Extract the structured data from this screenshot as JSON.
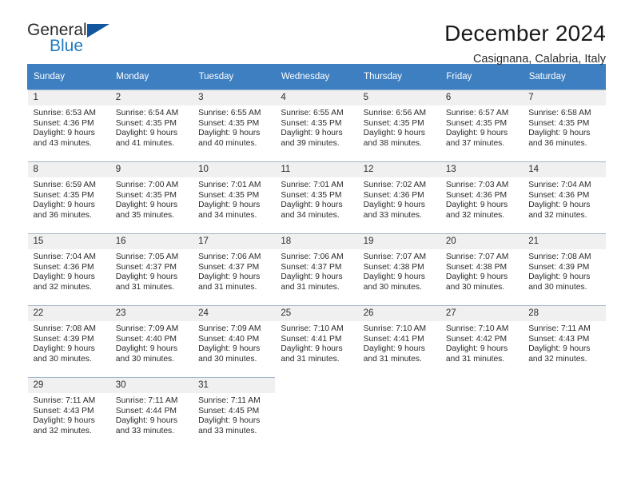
{
  "brand": {
    "name_primary": "General",
    "name_secondary": "Blue",
    "color_primary": "#2b2b2b",
    "color_secondary": "#1f7ac0",
    "triangle_color": "#1256a0"
  },
  "header": {
    "title": "December 2024",
    "subtitle": "Casignana, Calabria, Italy"
  },
  "theme": {
    "header_bg": "#3d7fc1",
    "header_text": "#ffffff",
    "daynum_bg": "#f0f0f0",
    "cell_border": "#9fb6cc",
    "body_text": "#2b2b2b"
  },
  "weekdays": [
    "Sunday",
    "Monday",
    "Tuesday",
    "Wednesday",
    "Thursday",
    "Friday",
    "Saturday"
  ],
  "weeks": [
    [
      {
        "day": "1",
        "sunrise": "Sunrise: 6:53 AM",
        "sunset": "Sunset: 4:36 PM",
        "daylight1": "Daylight: 9 hours",
        "daylight2": "and 43 minutes."
      },
      {
        "day": "2",
        "sunrise": "Sunrise: 6:54 AM",
        "sunset": "Sunset: 4:35 PM",
        "daylight1": "Daylight: 9 hours",
        "daylight2": "and 41 minutes."
      },
      {
        "day": "3",
        "sunrise": "Sunrise: 6:55 AM",
        "sunset": "Sunset: 4:35 PM",
        "daylight1": "Daylight: 9 hours",
        "daylight2": "and 40 minutes."
      },
      {
        "day": "4",
        "sunrise": "Sunrise: 6:55 AM",
        "sunset": "Sunset: 4:35 PM",
        "daylight1": "Daylight: 9 hours",
        "daylight2": "and 39 minutes."
      },
      {
        "day": "5",
        "sunrise": "Sunrise: 6:56 AM",
        "sunset": "Sunset: 4:35 PM",
        "daylight1": "Daylight: 9 hours",
        "daylight2": "and 38 minutes."
      },
      {
        "day": "6",
        "sunrise": "Sunrise: 6:57 AM",
        "sunset": "Sunset: 4:35 PM",
        "daylight1": "Daylight: 9 hours",
        "daylight2": "and 37 minutes."
      },
      {
        "day": "7",
        "sunrise": "Sunrise: 6:58 AM",
        "sunset": "Sunset: 4:35 PM",
        "daylight1": "Daylight: 9 hours",
        "daylight2": "and 36 minutes."
      }
    ],
    [
      {
        "day": "8",
        "sunrise": "Sunrise: 6:59 AM",
        "sunset": "Sunset: 4:35 PM",
        "daylight1": "Daylight: 9 hours",
        "daylight2": "and 36 minutes."
      },
      {
        "day": "9",
        "sunrise": "Sunrise: 7:00 AM",
        "sunset": "Sunset: 4:35 PM",
        "daylight1": "Daylight: 9 hours",
        "daylight2": "and 35 minutes."
      },
      {
        "day": "10",
        "sunrise": "Sunrise: 7:01 AM",
        "sunset": "Sunset: 4:35 PM",
        "daylight1": "Daylight: 9 hours",
        "daylight2": "and 34 minutes."
      },
      {
        "day": "11",
        "sunrise": "Sunrise: 7:01 AM",
        "sunset": "Sunset: 4:35 PM",
        "daylight1": "Daylight: 9 hours",
        "daylight2": "and 34 minutes."
      },
      {
        "day": "12",
        "sunrise": "Sunrise: 7:02 AM",
        "sunset": "Sunset: 4:36 PM",
        "daylight1": "Daylight: 9 hours",
        "daylight2": "and 33 minutes."
      },
      {
        "day": "13",
        "sunrise": "Sunrise: 7:03 AM",
        "sunset": "Sunset: 4:36 PM",
        "daylight1": "Daylight: 9 hours",
        "daylight2": "and 32 minutes."
      },
      {
        "day": "14",
        "sunrise": "Sunrise: 7:04 AM",
        "sunset": "Sunset: 4:36 PM",
        "daylight1": "Daylight: 9 hours",
        "daylight2": "and 32 minutes."
      }
    ],
    [
      {
        "day": "15",
        "sunrise": "Sunrise: 7:04 AM",
        "sunset": "Sunset: 4:36 PM",
        "daylight1": "Daylight: 9 hours",
        "daylight2": "and 32 minutes."
      },
      {
        "day": "16",
        "sunrise": "Sunrise: 7:05 AM",
        "sunset": "Sunset: 4:37 PM",
        "daylight1": "Daylight: 9 hours",
        "daylight2": "and 31 minutes."
      },
      {
        "day": "17",
        "sunrise": "Sunrise: 7:06 AM",
        "sunset": "Sunset: 4:37 PM",
        "daylight1": "Daylight: 9 hours",
        "daylight2": "and 31 minutes."
      },
      {
        "day": "18",
        "sunrise": "Sunrise: 7:06 AM",
        "sunset": "Sunset: 4:37 PM",
        "daylight1": "Daylight: 9 hours",
        "daylight2": "and 31 minutes."
      },
      {
        "day": "19",
        "sunrise": "Sunrise: 7:07 AM",
        "sunset": "Sunset: 4:38 PM",
        "daylight1": "Daylight: 9 hours",
        "daylight2": "and 30 minutes."
      },
      {
        "day": "20",
        "sunrise": "Sunrise: 7:07 AM",
        "sunset": "Sunset: 4:38 PM",
        "daylight1": "Daylight: 9 hours",
        "daylight2": "and 30 minutes."
      },
      {
        "day": "21",
        "sunrise": "Sunrise: 7:08 AM",
        "sunset": "Sunset: 4:39 PM",
        "daylight1": "Daylight: 9 hours",
        "daylight2": "and 30 minutes."
      }
    ],
    [
      {
        "day": "22",
        "sunrise": "Sunrise: 7:08 AM",
        "sunset": "Sunset: 4:39 PM",
        "daylight1": "Daylight: 9 hours",
        "daylight2": "and 30 minutes."
      },
      {
        "day": "23",
        "sunrise": "Sunrise: 7:09 AM",
        "sunset": "Sunset: 4:40 PM",
        "daylight1": "Daylight: 9 hours",
        "daylight2": "and 30 minutes."
      },
      {
        "day": "24",
        "sunrise": "Sunrise: 7:09 AM",
        "sunset": "Sunset: 4:40 PM",
        "daylight1": "Daylight: 9 hours",
        "daylight2": "and 30 minutes."
      },
      {
        "day": "25",
        "sunrise": "Sunrise: 7:10 AM",
        "sunset": "Sunset: 4:41 PM",
        "daylight1": "Daylight: 9 hours",
        "daylight2": "and 31 minutes."
      },
      {
        "day": "26",
        "sunrise": "Sunrise: 7:10 AM",
        "sunset": "Sunset: 4:41 PM",
        "daylight1": "Daylight: 9 hours",
        "daylight2": "and 31 minutes."
      },
      {
        "day": "27",
        "sunrise": "Sunrise: 7:10 AM",
        "sunset": "Sunset: 4:42 PM",
        "daylight1": "Daylight: 9 hours",
        "daylight2": "and 31 minutes."
      },
      {
        "day": "28",
        "sunrise": "Sunrise: 7:11 AM",
        "sunset": "Sunset: 4:43 PM",
        "daylight1": "Daylight: 9 hours",
        "daylight2": "and 32 minutes."
      }
    ],
    [
      {
        "day": "29",
        "sunrise": "Sunrise: 7:11 AM",
        "sunset": "Sunset: 4:43 PM",
        "daylight1": "Daylight: 9 hours",
        "daylight2": "and 32 minutes."
      },
      {
        "day": "30",
        "sunrise": "Sunrise: 7:11 AM",
        "sunset": "Sunset: 4:44 PM",
        "daylight1": "Daylight: 9 hours",
        "daylight2": "and 33 minutes."
      },
      {
        "day": "31",
        "sunrise": "Sunrise: 7:11 AM",
        "sunset": "Sunset: 4:45 PM",
        "daylight1": "Daylight: 9 hours",
        "daylight2": "and 33 minutes."
      },
      {
        "day": "",
        "sunrise": "",
        "sunset": "",
        "daylight1": "",
        "daylight2": ""
      },
      {
        "day": "",
        "sunrise": "",
        "sunset": "",
        "daylight1": "",
        "daylight2": ""
      },
      {
        "day": "",
        "sunrise": "",
        "sunset": "",
        "daylight1": "",
        "daylight2": ""
      },
      {
        "day": "",
        "sunrise": "",
        "sunset": "",
        "daylight1": "",
        "daylight2": ""
      }
    ]
  ]
}
